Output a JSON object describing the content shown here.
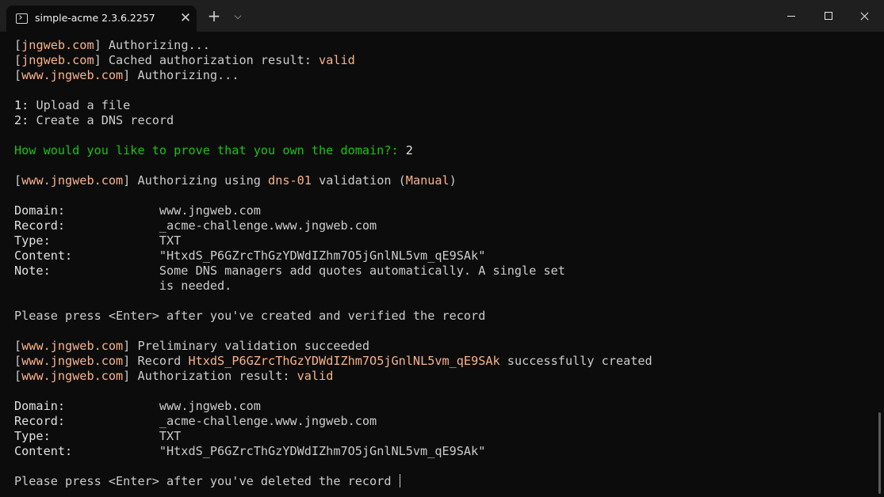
{
  "window": {
    "tab_title": "simple-acme 2.3.6.2257",
    "tab_close": "✕",
    "new_tab": "+",
    "dropdown": "⌵"
  },
  "colors": {
    "background": "#0c0c0c",
    "titlebar": "#1f1f1f",
    "text": "#cccccc",
    "highlight": "#f9b38b",
    "prompt_green": "#16c60c"
  },
  "terminal": {
    "lines": [
      [
        [
          "[",
          ""
        ],
        [
          "jngweb.com",
          "y"
        ],
        [
          "] Authorizing...",
          ""
        ]
      ],
      [
        [
          "[",
          ""
        ],
        [
          "jngweb.com",
          "y"
        ],
        [
          "] Cached authorization result: ",
          ""
        ],
        [
          "valid",
          "y"
        ]
      ],
      [
        [
          "[",
          ""
        ],
        [
          "www.jngweb.com",
          "y"
        ],
        [
          "] Authorizing...",
          ""
        ]
      ],
      [],
      [
        [
          "1: ",
          "w"
        ],
        [
          "Upload a file",
          ""
        ]
      ],
      [
        [
          "2: ",
          "w"
        ],
        [
          "Create a DNS record",
          ""
        ]
      ],
      [],
      [
        [
          "How would you like to prove that you own the domain?: ",
          "g"
        ],
        [
          "2",
          "w"
        ]
      ],
      [],
      [
        [
          "[",
          ""
        ],
        [
          "www.jngweb.com",
          "y"
        ],
        [
          "] Authorizing using ",
          ""
        ],
        [
          "dns-01",
          "y"
        ],
        [
          " validation (",
          ""
        ],
        [
          "Manual",
          "y"
        ],
        [
          ")",
          ""
        ]
      ],
      [],
      [
        [
          "Domain:",
          "w"
        ],
        [
          "             www.jngweb.com",
          ""
        ]
      ],
      [
        [
          "Record:",
          "w"
        ],
        [
          "             _acme-challenge.www.jngweb.com",
          ""
        ]
      ],
      [
        [
          "Type:",
          "w"
        ],
        [
          "               TXT",
          ""
        ]
      ],
      [
        [
          "Content:",
          "w"
        ],
        [
          "            \"HtxdS_P6GZrcThGzYDWdIZhm7O5jGnlNL5vm_qE9SAk\"",
          ""
        ]
      ],
      [
        [
          "Note:",
          "w"
        ],
        [
          "               Some DNS managers add quotes automatically. A single set",
          ""
        ]
      ],
      [
        [
          "                    is needed.",
          ""
        ]
      ],
      [],
      [
        [
          "Please press <Enter> after you've created and verified the record",
          ""
        ]
      ],
      [],
      [
        [
          "[",
          ""
        ],
        [
          "www.jngweb.com",
          "y"
        ],
        [
          "] Preliminary validation succeeded",
          ""
        ]
      ],
      [
        [
          "[",
          ""
        ],
        [
          "www.jngweb.com",
          "y"
        ],
        [
          "] Record ",
          ""
        ],
        [
          "HtxdS_P6GZrcThGzYDWdIZhm7O5jGnlNL5vm_qE9SAk",
          "y"
        ],
        [
          " successfully created",
          ""
        ]
      ],
      [
        [
          "[",
          ""
        ],
        [
          "www.jngweb.com",
          "y"
        ],
        [
          "] Authorization result: ",
          ""
        ],
        [
          "valid",
          "y"
        ]
      ],
      [],
      [
        [
          "Domain:",
          "w"
        ],
        [
          "             www.jngweb.com",
          ""
        ]
      ],
      [
        [
          "Record:",
          "w"
        ],
        [
          "             _acme-challenge.www.jngweb.com",
          ""
        ]
      ],
      [
        [
          "Type:",
          "w"
        ],
        [
          "               TXT",
          ""
        ]
      ],
      [
        [
          "Content:",
          "w"
        ],
        [
          "            \"HtxdS_P6GZrcThGzYDWdIZhm7O5jGnlNL5vm_qE9SAk\"",
          ""
        ]
      ],
      [],
      [
        [
          "Please press <Enter> after you've deleted the record ",
          ""
        ]
      ]
    ]
  }
}
